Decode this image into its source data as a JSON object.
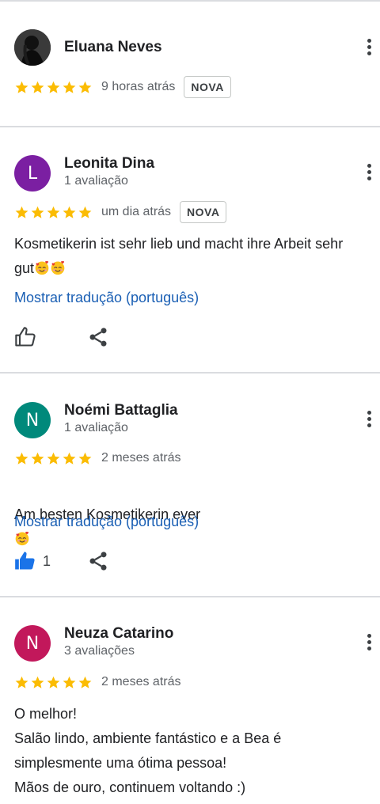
{
  "reviews": [
    {
      "name": "Eluana Neves",
      "review_count": "",
      "avatar_letter": "",
      "avatar_color": "#2b2b2b",
      "rating": 5,
      "date": "9 horas atrás",
      "badge": "NOVA",
      "text": "",
      "translate_label": "",
      "likes": ""
    },
    {
      "name": "Leonita Dina",
      "review_count": "1 avaliação",
      "avatar_letter": "L",
      "avatar_color": "#7b1fa2",
      "rating": 5,
      "date": "um dia atrás",
      "badge": "NOVA",
      "text_line1": "Kosmetikerin ist sehr lieb und macht ihre Arbeit sehr",
      "text_line2": "gut",
      "translate_label": "Mostrar tradução (português)",
      "likes": ""
    },
    {
      "name": "Noémi Battaglia",
      "review_count": "1 avaliação",
      "avatar_letter": "N",
      "avatar_color": "#00897b",
      "rating": 5,
      "date": "2 meses atrás",
      "badge": "",
      "text_line1": "Am besten Kosmetikerin ever",
      "translate_label": "Mostrar tradução (português)",
      "likes": "1"
    },
    {
      "name": "Neuza Catarino",
      "review_count": "3 avaliações",
      "avatar_letter": "N",
      "avatar_color": "#c2185b",
      "rating": 5,
      "date": "2 meses atrás",
      "badge": "",
      "text": "O melhor!\nSalão lindo, ambiente fantástico e a Bea é\nsimplesmente uma ótima pessoa!\nMãos de ouro, continuem voltando :)",
      "translate_label": "",
      "likes": ""
    }
  ],
  "colors": {
    "star": "#fbbc04",
    "link": "#1a5fb4",
    "like_active": "#1a73e8",
    "divider": "#dadce0"
  },
  "icons": [
    "more-vert-icon",
    "thumb-up-icon",
    "share-icon",
    "star-icon",
    "smiling-face-with-hearts-emoji"
  ]
}
